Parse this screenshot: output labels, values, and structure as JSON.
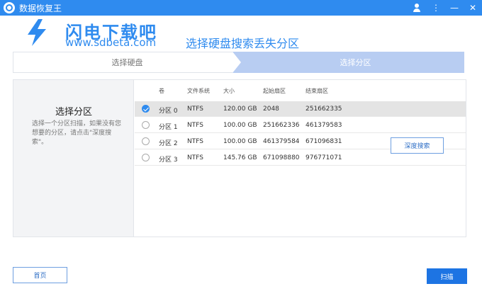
{
  "window": {
    "title": "数据恢复王"
  },
  "titlebar": {
    "user_icon": "user-icon",
    "menu_glyph": "⋮",
    "minimize_glyph": "—",
    "close_glyph": "✕"
  },
  "watermark": {
    "cn": "闪电下载吧",
    "en": "www.sdbeta.com",
    "color": "#2f8bef"
  },
  "header": {
    "step_title": "选择硬盘搜索丢失分区"
  },
  "steps": [
    {
      "label": "选择硬盘"
    },
    {
      "label": "选择分区"
    }
  ],
  "left_panel": {
    "title": "选择分区",
    "description": "选择一个分区扫描，如果没有您想要的分区，请点击\"深度搜索\"。"
  },
  "table": {
    "headers": [
      "卷",
      "文件系统",
      "大小",
      "起始扇区",
      "结束扇区"
    ],
    "rows": [
      {
        "selected": true,
        "volume": "分区 0",
        "fs": "NTFS",
        "size": "120.00 GB",
        "start": "2048",
        "end": "251662335"
      },
      {
        "selected": false,
        "volume": "分区 1",
        "fs": "NTFS",
        "size": "100.00 GB",
        "start": "251662336",
        "end": "461379583"
      },
      {
        "selected": false,
        "volume": "分区 2",
        "fs": "NTFS",
        "size": "100.00 GB",
        "start": "461379584",
        "end": "671096831"
      },
      {
        "selected": false,
        "volume": "分区 3",
        "fs": "NTFS",
        "size": "145.76 GB",
        "start": "671098880",
        "end": "976771071"
      }
    ]
  },
  "buttons": {
    "deep_search": "深度搜索",
    "home": "首页",
    "scan": "扫描"
  },
  "colors": {
    "accent": "#2f8bef",
    "step_active": "#b8cdf2",
    "scan_button": "#1d74e3"
  }
}
